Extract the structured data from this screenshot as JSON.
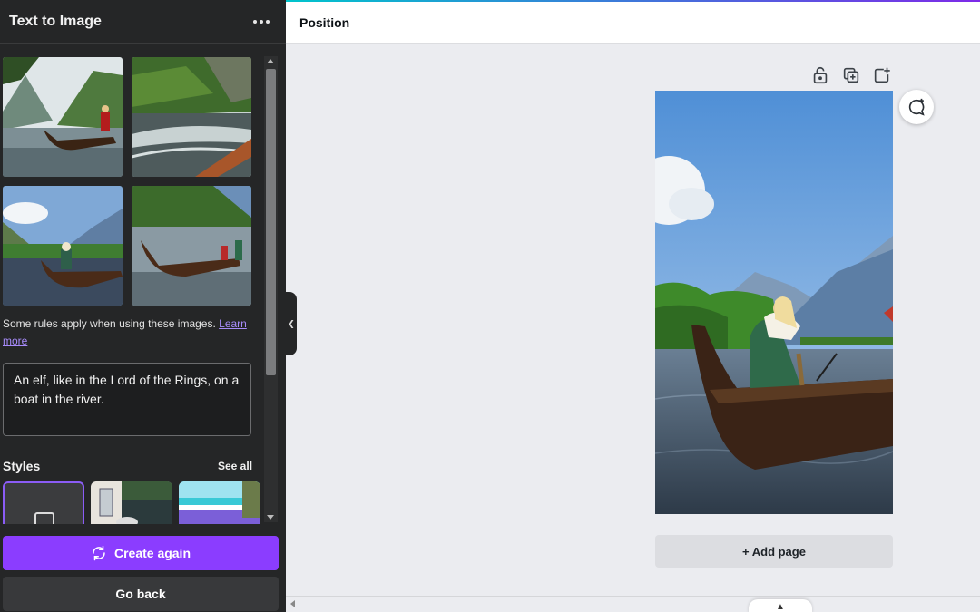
{
  "panel": {
    "title": "Text to Image",
    "rules_text": "Some rules apply when using these images. ",
    "learn_more": "Learn more",
    "prompt": "An elf, like in the Lord of the Rings, on a boat in the river.",
    "styles_label": "Styles",
    "see_all": "See all",
    "create_again": "Create again",
    "go_back": "Go back"
  },
  "topbar": {
    "position": "Position"
  },
  "canvas": {
    "add_page": "+ Add page"
  },
  "icons": {
    "more": "more-icon",
    "lock": "lock-icon",
    "duplicate": "duplicate-icon",
    "add_page_export": "add-export-icon",
    "comment": "comment-add-icon",
    "refresh": "refresh-icon",
    "collapse": "chevron-left-icon",
    "expand": "chevron-up-icon"
  },
  "colors": {
    "accent": "#8b3dff",
    "panel_bg": "#252627",
    "canvas_bg": "#ebecf0"
  }
}
